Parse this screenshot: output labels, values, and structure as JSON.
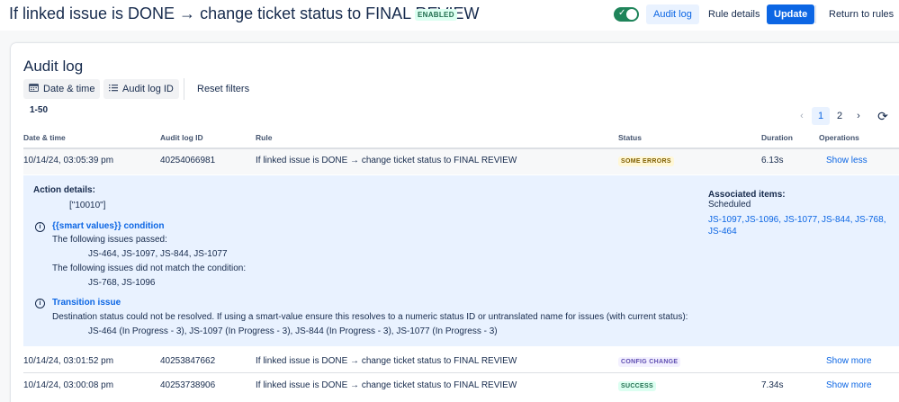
{
  "header": {
    "title": "If linked issue is DONE → change ticket status to FINAL REVIEW",
    "badge": "ENABLED",
    "buttons": {
      "audit_log": "Audit log",
      "rule_details": "Rule details",
      "update": "Update",
      "return": "Return to rules"
    },
    "toggle_on": true
  },
  "audit": {
    "heading": "Audit log",
    "filters": {
      "date_time": "Date & time",
      "audit_log_id": "Audit log ID",
      "reset": "Reset filters"
    },
    "range": "1-50",
    "pagination": {
      "pages": [
        "1",
        "2"
      ],
      "current": "1"
    },
    "columns": {
      "date": "Date & time",
      "id": "Audit log ID",
      "rule": "Rule",
      "status": "Status",
      "duration": "Duration",
      "operations": "Operations"
    },
    "rows": [
      {
        "date": "10/14/24, 03:05:39 pm",
        "id": "40254066981",
        "rule": "If linked issue is DONE → change ticket status to FINAL REVIEW",
        "status": "SOME ERRORS",
        "duration": "6.13s",
        "action": "Show less"
      },
      {
        "date": "10/14/24, 03:01:52 pm",
        "id": "40253847662",
        "rule": "If linked issue is DONE → change ticket status to FINAL REVIEW",
        "status": "CONFIG CHANGE",
        "duration": "",
        "action": "Show more"
      },
      {
        "date": "10/14/24, 03:00:08 pm",
        "id": "40253738906",
        "rule": "If linked issue is DONE → change ticket status to FINAL REVIEW",
        "status": "SUCCESS",
        "duration": "7.34s",
        "action": "Show more"
      }
    ],
    "details": {
      "action_label": "Action details:",
      "action_value": "[\"10010\"]",
      "condition": {
        "title": "{{smart values}} condition",
        "passed_label": "The following issues passed:",
        "passed": "JS-464, JS-1097, JS-844, JS-1077",
        "failed_label": "The following issues did not match the condition:",
        "failed": "JS-768, JS-1096"
      },
      "transition": {
        "title": "Transition issue",
        "message": "Destination status could not be resolved. If using a smart-value ensure this resolves to a numeric status ID or untranslated name for issues (with current status):",
        "issues": "JS-464 (In Progress - 3), JS-1097 (In Progress - 3), JS-844 (In Progress - 3), JS-1077 (In Progress - 3)"
      },
      "associated": {
        "label": "Associated items:",
        "sub": "Scheduled",
        "items": [
          "JS-1097",
          "JS-1096",
          "JS-1077",
          "JS-844",
          "JS-768",
          "JS-464"
        ]
      }
    }
  },
  "colors": {
    "primary": "#0c66e4",
    "toggle": "#1f845a",
    "details_bg": "#e9f2ff"
  }
}
